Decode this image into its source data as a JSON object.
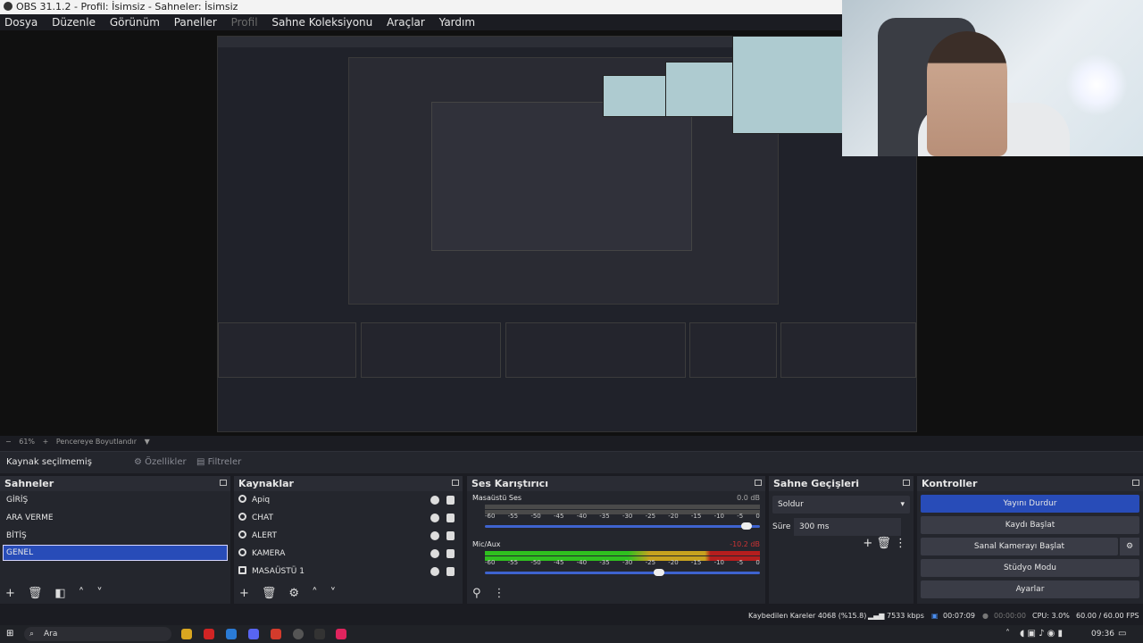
{
  "window": {
    "title": "OBS 31.1.2 - Profil: İsimsiz - Sahneler: İsimsiz"
  },
  "menu": [
    "Dosya",
    "Düzenle",
    "Görünüm",
    "Paneller",
    "Profil",
    "Sahne Koleksiyonu",
    "Araçlar",
    "Yardım"
  ],
  "zoom": {
    "percent": "61%",
    "fit_label": "Pencereye Boyutlandır"
  },
  "source_toolbar": {
    "no_source": "Kaynak seçilmemiş",
    "properties": "Özellikler",
    "filters": "Filtreler"
  },
  "scenes": {
    "title": "Sahneler",
    "items": [
      "GİRİŞ",
      "ARA VERME",
      "BİTİŞ",
      "GENEL"
    ],
    "selected": "GENEL"
  },
  "sources": {
    "title": "Kaynaklar",
    "items": [
      "Apiq",
      "CHAT",
      "ALERT",
      "KAMERA",
      "MASAÜSTÜ 1"
    ]
  },
  "mixer": {
    "title": "Ses Karıştırıcı",
    "channels": [
      {
        "name": "Masaüstü Ses",
        "db": "0.0 dB",
        "level_fraction": 0.0,
        "volume_fraction": 0.97
      },
      {
        "name": "Mic/Aux",
        "db": "-10.2 dB",
        "level_fraction": 0.62,
        "volume_fraction": 0.64
      }
    ],
    "ticks": [
      "-60",
      "-55",
      "-50",
      "-45",
      "-40",
      "-35",
      "-30",
      "-25",
      "-20",
      "-15",
      "-10",
      "-5",
      "0"
    ]
  },
  "transitions": {
    "title": "Sahne Geçişleri",
    "type": "Soldur",
    "duration_label": "Süre",
    "duration": "300 ms"
  },
  "controls": {
    "title": "Kontroller",
    "buttons": [
      "Yayını Durdur",
      "Kaydı Başlat",
      "Sanal Kamerayı Başlat",
      "Stüdyo Modu",
      "Ayarlar"
    ]
  },
  "status": {
    "dropped": "Kaybedilen Kareler 4068 (%15.8)",
    "bitrate": "7533 kbps",
    "stream_time": "00:07:09",
    "rec_time": "00:00:00",
    "cpu": "CPU: 3.0%",
    "fps": "60.00 / 60.00 FPS"
  },
  "taskbar": {
    "search": "Ara",
    "clock": "09:36"
  },
  "colors": {
    "accent": "#284cb8",
    "meter_green": "#2fc01f",
    "meter_yellow": "#c7a21f",
    "meter_red": "#b51e1e"
  }
}
